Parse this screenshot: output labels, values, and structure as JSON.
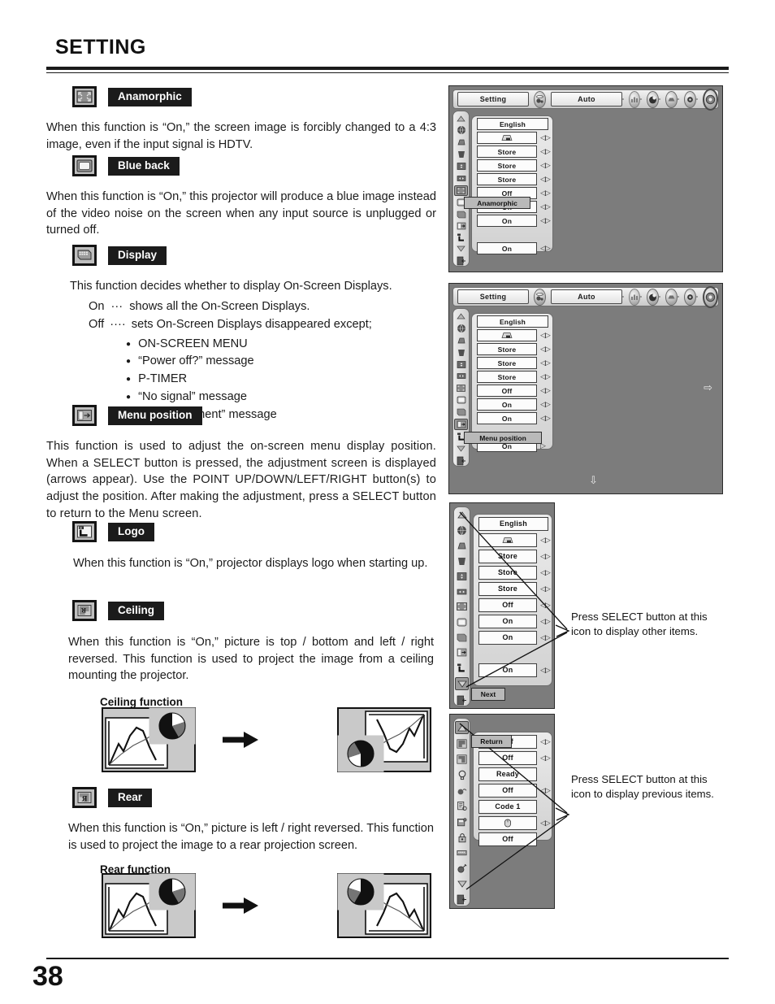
{
  "page": {
    "title": "SETTING",
    "number": "38"
  },
  "sections": [
    {
      "id": "anamorphic",
      "icon": "anamorphic-icon",
      "label": "Anamorphic",
      "body": "When this function is “On,” the screen image is forcibly changed to a 4:3 image, even if the input signal is HDTV."
    },
    {
      "id": "blue-back",
      "icon": "blue-back-icon",
      "label": "Blue back",
      "body": "When this function is “On,” this projector will produce a blue image instead of the video noise on the screen when any input source is unplugged or turned off."
    },
    {
      "id": "display",
      "icon": "display-icon",
      "label": "Display",
      "body": "This function decides whether to display On-Screen Displays.",
      "on_label": "On",
      "on_dots": "···",
      "on_text": "shows all the On-Screen Displays.",
      "off_label": "Off",
      "off_dots": "····",
      "off_text": "sets On-Screen Displays disappeared except;",
      "exceptions": [
        "ON-SCREEN MENU",
        "“Power off?” message",
        "P-TIMER",
        "“No signal” message",
        "“Wait a moment” message"
      ]
    },
    {
      "id": "menu-position",
      "icon": "menu-position-icon",
      "label": "Menu position",
      "body": "This function is used to adjust the on-screen menu display position. When a SELECT button is pressed, the adjustment screen is displayed (arrows appear). Use the POINT UP/DOWN/LEFT/RIGHT button(s) to adjust the position. After making the adjustment, press a SELECT button to return to the Menu screen."
    },
    {
      "id": "logo",
      "icon": "logo-icon",
      "label": "Logo",
      "body": "When this function is “On,” projector displays logo when starting up."
    },
    {
      "id": "ceiling",
      "icon": "ceiling-icon",
      "label": "Ceiling",
      "body": "When this function is “On,” picture is top / bottom and left / right reversed.  This function is used to project the image from a ceiling mounting the projector.",
      "figure_caption": "Ceiling function"
    },
    {
      "id": "rear",
      "icon": "rear-icon",
      "label": "Rear",
      "body": "When this function is “On,” picture is left / right reversed.  This function is used to project the image to a rear projection screen.",
      "figure_caption": "Rear function"
    }
  ],
  "osd": {
    "menu_bar": {
      "menu_label": "Setting",
      "input_label": "Auto",
      "icons": [
        "image-level-icon",
        "image-adjust-icon",
        "screen-icon",
        "sound-icon",
        "setting-gear-icon"
      ],
      "source_icon": "input-source-icon"
    },
    "panel1": {
      "name": "setting-menu-anamorphic",
      "rows": [
        {
          "value": "English",
          "arrows": false
        },
        {
          "value": "",
          "arrows": true,
          "icon": "keystone-icon"
        },
        {
          "value": "Store",
          "arrows": true
        },
        {
          "value": "Store",
          "arrows": true
        },
        {
          "value": "Store",
          "arrows": true
        },
        {
          "value": "Off",
          "arrows": true
        },
        {
          "value": "On",
          "arrows": true,
          "highlight": "Anamorphic"
        },
        {
          "value": "On",
          "arrows": true
        },
        {
          "value": "",
          "arrows": false
        },
        {
          "value": "On",
          "arrows": true
        }
      ],
      "highlight_label": "Anamorphic"
    },
    "panel2": {
      "name": "setting-menu-menu-position",
      "rows": [
        {
          "value": "English",
          "arrows": false
        },
        {
          "value": "",
          "arrows": true,
          "icon": "keystone-icon"
        },
        {
          "value": "Store",
          "arrows": true
        },
        {
          "value": "Store",
          "arrows": true
        },
        {
          "value": "Store",
          "arrows": true
        },
        {
          "value": "Off",
          "arrows": true
        },
        {
          "value": "On",
          "arrows": true
        },
        {
          "value": "On",
          "arrows": true
        },
        {
          "value": "",
          "arrows": false
        },
        {
          "value": "On",
          "arrows": true,
          "highlight": "Menu position"
        }
      ],
      "highlight_label": "Menu position",
      "right_arrow": "⇨",
      "down_arrow": "⇩"
    },
    "panel3": {
      "name": "setting-menu-next",
      "rows": [
        {
          "value": "English",
          "arrows": false
        },
        {
          "value": "",
          "arrows": true,
          "icon": "keystone-icon"
        },
        {
          "value": "Store",
          "arrows": true
        },
        {
          "value": "Store",
          "arrows": true
        },
        {
          "value": "Store",
          "arrows": true
        },
        {
          "value": "Off",
          "arrows": true
        },
        {
          "value": "On",
          "arrows": true
        },
        {
          "value": "On",
          "arrows": true
        },
        {
          "value": "",
          "arrows": false
        },
        {
          "value": "On",
          "arrows": true
        }
      ],
      "highlight_label": "Next",
      "callout": "Press SELECT button at this icon to display other items."
    },
    "panel4": {
      "name": "setting-menu-return",
      "rows": [
        {
          "value": "Off",
          "arrows": true,
          "highlight": "Return"
        },
        {
          "value": "Off",
          "arrows": true
        },
        {
          "value": "Ready",
          "arrows": false
        },
        {
          "value": "Off",
          "arrows": true
        },
        {
          "value": "Code 1",
          "arrows": false
        },
        {
          "value": "",
          "arrows": true,
          "icon": "mouse-icon"
        },
        {
          "value": "Off",
          "arrows": false
        }
      ],
      "highlight_label": "Return",
      "callout": "Press SELECT button at this icon to display previous items."
    }
  }
}
